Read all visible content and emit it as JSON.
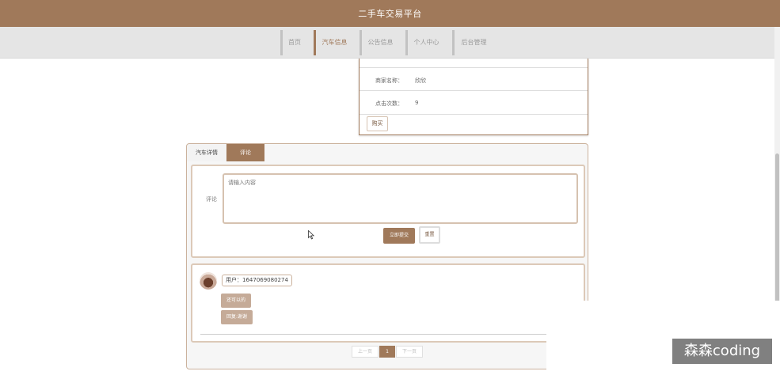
{
  "header": {
    "title": "二手车交易平台",
    "accent_color": "#a0795a"
  },
  "nav": {
    "items": [
      {
        "label": "首页"
      },
      {
        "label": "汽车信息"
      },
      {
        "label": "公告信息"
      },
      {
        "label": "个人中心"
      },
      {
        "label": "后台管理"
      }
    ],
    "active_index": 1
  },
  "detail": {
    "rows": [
      {
        "label": "商家名称：",
        "value": "欣欣"
      },
      {
        "label": "点击次数：",
        "value": "9"
      }
    ],
    "buy_label": "购买"
  },
  "tabs": [
    {
      "label": "汽车详情"
    },
    {
      "label": "评论"
    }
  ],
  "active_tab": 1,
  "comment_form": {
    "label": "评论",
    "placeholder": "请输入内容",
    "submit_label": "立即提交",
    "reset_label": "重置"
  },
  "comments": [
    {
      "user": "用户：1647069080274",
      "content": "还可以的",
      "reply": "回复:谢谢"
    }
  ],
  "pagination": {
    "prev": "上一页",
    "current": "1",
    "next": "下一页"
  },
  "watermark": "森森coding"
}
